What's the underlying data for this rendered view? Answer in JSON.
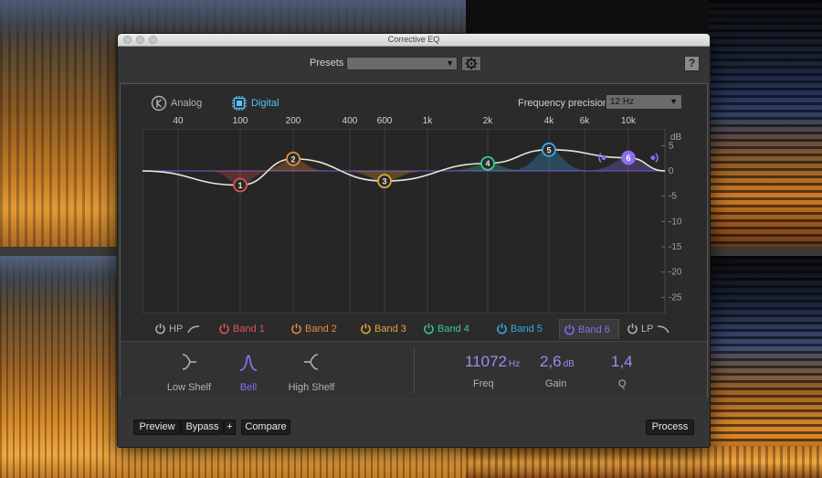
{
  "window": {
    "title": "Corrective EQ"
  },
  "presets": {
    "label": "Presets",
    "value": ""
  },
  "help": {
    "label": "?"
  },
  "modes": {
    "analog": "Analog",
    "digital": "Digital",
    "selected": "Digital"
  },
  "frequency_precision": {
    "label": "Frequency precision",
    "value": "12 Hz"
  },
  "graph": {
    "freq_ticks": [
      "40",
      "100",
      "200",
      "400",
      "600",
      "1k",
      "2k",
      "4k",
      "6k",
      "10k"
    ],
    "db_unit": "dB",
    "db_ticks": [
      "5",
      "0",
      "-5",
      "-10",
      "-15",
      "-20",
      "-25"
    ],
    "bands": [
      {
        "id": "1",
        "color": "#e05252",
        "freq_label": "100",
        "gain_db": -2.8
      },
      {
        "id": "2",
        "color": "#e58a3a",
        "freq_label": "200",
        "gain_db": 2.4
      },
      {
        "id": "3",
        "color": "#e6a53a",
        "freq_label": "600",
        "gain_db": -2.0
      },
      {
        "id": "4",
        "color": "#3cc79a",
        "freq_label": "2k",
        "gain_db": 1.5
      },
      {
        "id": "5",
        "color": "#3aa9e8",
        "freq_label": "4k",
        "gain_db": 4.2
      },
      {
        "id": "6",
        "color": "#8a6cf0",
        "freq_label": "10k",
        "gain_db": 2.6
      }
    ]
  },
  "tabs": [
    {
      "label": "HP",
      "color": "#aeb2b6"
    },
    {
      "label": "Band 1",
      "color": "#e05252"
    },
    {
      "label": "Band 2",
      "color": "#e58a3a"
    },
    {
      "label": "Band 3",
      "color": "#e6a53a"
    },
    {
      "label": "Band 4",
      "color": "#3cc79a"
    },
    {
      "label": "Band 5",
      "color": "#3aa9e8"
    },
    {
      "label": "Band 6",
      "color": "#8a6cf0",
      "active": true
    },
    {
      "label": "LP",
      "color": "#aeb2b6"
    }
  ],
  "filter_shapes": [
    {
      "label": "Low Shelf",
      "selected": false
    },
    {
      "label": "Bell",
      "selected": true
    },
    {
      "label": "High Shelf",
      "selected": false
    }
  ],
  "params": {
    "freq": {
      "value": "11072",
      "unit": "Hz",
      "label": "Freq"
    },
    "gain": {
      "value": "2,6",
      "unit": "dB",
      "label": "Gain"
    },
    "q": {
      "value": "1,4",
      "label": "Q"
    }
  },
  "buttons": {
    "preview": "Preview",
    "bypass": "Bypass",
    "plus": "+",
    "compare": "Compare",
    "process": "Process"
  },
  "colors": {
    "accent_digital": "#55c1f2",
    "active_band": "#8a6cf0",
    "curve": "#e9e6dc"
  }
}
